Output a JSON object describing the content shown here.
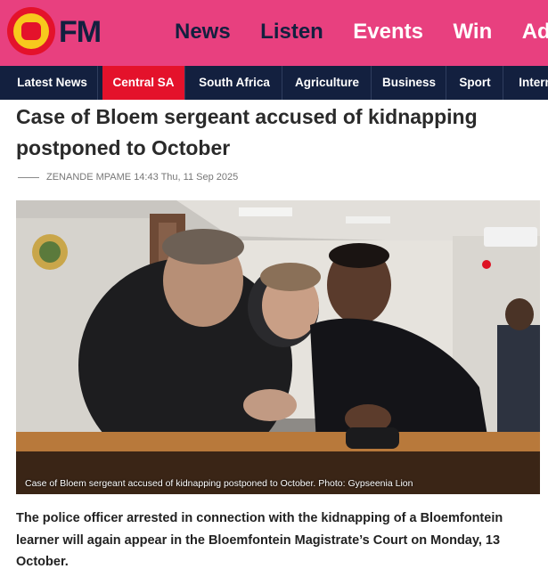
{
  "brand": {
    "logo_text": "OFM"
  },
  "main_nav": [
    "News",
    "Listen",
    "Events",
    "Win",
    "Adv"
  ],
  "categories": [
    "Latest News",
    "Central SA",
    "South Africa",
    "Agriculture",
    "Business",
    "Sport",
    "Intern"
  ],
  "active_category": "Central SA",
  "article": {
    "title": "Case of Bloem sergeant accused of kidnapping postponed to October",
    "byline": "ZENANDE MPAME 14:43 Thu, 11 Sep 2025",
    "image_caption": "Case of Bloem sergeant accused of kidnapping postponed to October. Photo: Gypseenia Lion",
    "lead": "The police officer arrested in connection with the kidnapping of a Bloemfontein learner will again appear in the Bloemfontein Magistrate’s Court on Monday, 13 October."
  },
  "colors": {
    "header_pink": "#e8407f",
    "nav_navy": "#13203f",
    "active_red": "#e4122b",
    "logo_yellow": "#f7c91d"
  }
}
